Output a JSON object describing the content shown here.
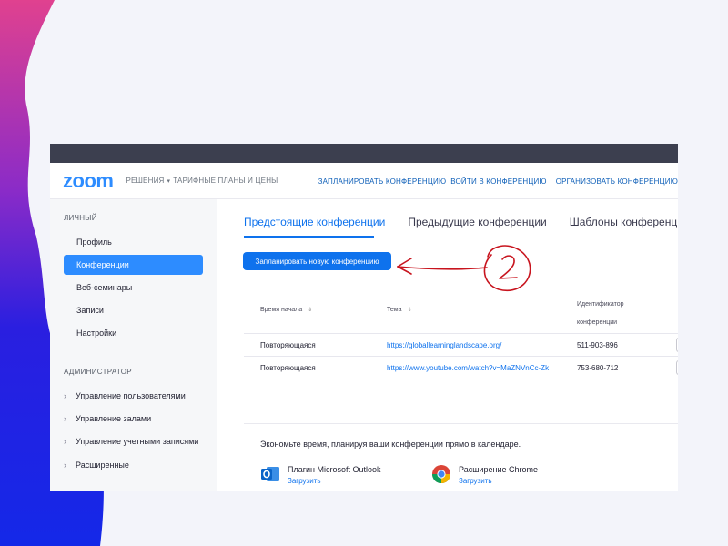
{
  "colors": {
    "accent": "#2d8cff",
    "link": "#0e72ed",
    "header_strip": "#3c3f4f",
    "annotation": "#c8141e",
    "outlook_blue": "#0a64c8"
  },
  "header": {
    "logo": "zoom",
    "nav_left": [
      "РЕШЕНИЯ",
      "ТАРИФНЫЕ ПЛАНЫ И ЦЕНЫ"
    ],
    "nav_right": [
      "ЗАПЛАНИРОВАТЬ КОНФЕРЕНЦИЮ",
      "ВОЙТИ В КОНФЕРЕНЦИЮ",
      "ОРГАНИЗОВАТЬ КОНФЕРЕНЦИЮ"
    ]
  },
  "sidebar": {
    "personal_label": "ЛИЧНЫЙ",
    "items": [
      "Профиль",
      "Конференции",
      "Веб-семинары",
      "Записи",
      "Настройки"
    ],
    "admin_label": "АДМИНИСТРАТОР",
    "admin_items": [
      "Управление пользователями",
      "Управление залами",
      "Управление учетными записями",
      "Расширенные"
    ]
  },
  "main": {
    "tabs": [
      "Предстоящие конференции",
      "Предыдущие конференции",
      "Шаблоны конференций"
    ],
    "schedule_button": "Запланировать новую конференцию",
    "table": {
      "headers": {
        "start_time": "Время начала",
        "topic": "Тема",
        "id_line1": "Идентификатор",
        "id_line2": "конференции"
      },
      "rows": [
        {
          "time": "Повторяющаяся",
          "topic": "https://globallearninglandscape.org/",
          "id": "511-903-896"
        },
        {
          "time": "Повторяющаяся",
          "topic": "https://www.youtube.com/watch?v=MaZNVnCc-Zk",
          "id": "753-680-712"
        }
      ]
    },
    "promo": {
      "title": "Экономьте время, планируя ваши конференции прямо в календаре.",
      "outlook_name": "Плагин Microsoft Outlook",
      "outlook_download": "Загрузить",
      "chrome_name": "Расширение Chrome",
      "chrome_download": "Загрузить"
    }
  },
  "annotation": {
    "icon": "handwritten-arrow-circle",
    "number": "2"
  }
}
